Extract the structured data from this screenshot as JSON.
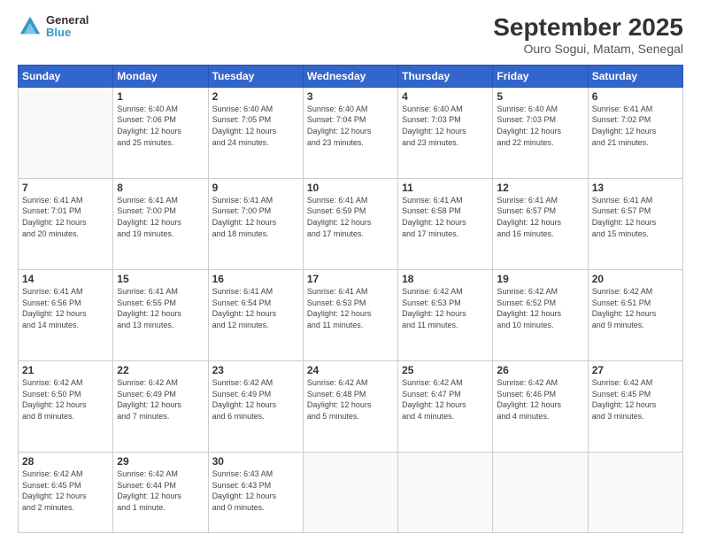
{
  "logo": {
    "line1": "General",
    "line2": "Blue"
  },
  "title": "September 2025",
  "subtitle": "Ouro Sogui, Matam, Senegal",
  "days_header": [
    "Sunday",
    "Monday",
    "Tuesday",
    "Wednesday",
    "Thursday",
    "Friday",
    "Saturday"
  ],
  "weeks": [
    [
      {
        "day": "",
        "info": ""
      },
      {
        "day": "1",
        "info": "Sunrise: 6:40 AM\nSunset: 7:06 PM\nDaylight: 12 hours\nand 25 minutes."
      },
      {
        "day": "2",
        "info": "Sunrise: 6:40 AM\nSunset: 7:05 PM\nDaylight: 12 hours\nand 24 minutes."
      },
      {
        "day": "3",
        "info": "Sunrise: 6:40 AM\nSunset: 7:04 PM\nDaylight: 12 hours\nand 23 minutes."
      },
      {
        "day": "4",
        "info": "Sunrise: 6:40 AM\nSunset: 7:03 PM\nDaylight: 12 hours\nand 23 minutes."
      },
      {
        "day": "5",
        "info": "Sunrise: 6:40 AM\nSunset: 7:03 PM\nDaylight: 12 hours\nand 22 minutes."
      },
      {
        "day": "6",
        "info": "Sunrise: 6:41 AM\nSunset: 7:02 PM\nDaylight: 12 hours\nand 21 minutes."
      }
    ],
    [
      {
        "day": "7",
        "info": "Sunrise: 6:41 AM\nSunset: 7:01 PM\nDaylight: 12 hours\nand 20 minutes."
      },
      {
        "day": "8",
        "info": "Sunrise: 6:41 AM\nSunset: 7:00 PM\nDaylight: 12 hours\nand 19 minutes."
      },
      {
        "day": "9",
        "info": "Sunrise: 6:41 AM\nSunset: 7:00 PM\nDaylight: 12 hours\nand 18 minutes."
      },
      {
        "day": "10",
        "info": "Sunrise: 6:41 AM\nSunset: 6:59 PM\nDaylight: 12 hours\nand 17 minutes."
      },
      {
        "day": "11",
        "info": "Sunrise: 6:41 AM\nSunset: 6:58 PM\nDaylight: 12 hours\nand 17 minutes."
      },
      {
        "day": "12",
        "info": "Sunrise: 6:41 AM\nSunset: 6:57 PM\nDaylight: 12 hours\nand 16 minutes."
      },
      {
        "day": "13",
        "info": "Sunrise: 6:41 AM\nSunset: 6:57 PM\nDaylight: 12 hours\nand 15 minutes."
      }
    ],
    [
      {
        "day": "14",
        "info": "Sunrise: 6:41 AM\nSunset: 6:56 PM\nDaylight: 12 hours\nand 14 minutes."
      },
      {
        "day": "15",
        "info": "Sunrise: 6:41 AM\nSunset: 6:55 PM\nDaylight: 12 hours\nand 13 minutes."
      },
      {
        "day": "16",
        "info": "Sunrise: 6:41 AM\nSunset: 6:54 PM\nDaylight: 12 hours\nand 12 minutes."
      },
      {
        "day": "17",
        "info": "Sunrise: 6:41 AM\nSunset: 6:53 PM\nDaylight: 12 hours\nand 11 minutes."
      },
      {
        "day": "18",
        "info": "Sunrise: 6:42 AM\nSunset: 6:53 PM\nDaylight: 12 hours\nand 11 minutes."
      },
      {
        "day": "19",
        "info": "Sunrise: 6:42 AM\nSunset: 6:52 PM\nDaylight: 12 hours\nand 10 minutes."
      },
      {
        "day": "20",
        "info": "Sunrise: 6:42 AM\nSunset: 6:51 PM\nDaylight: 12 hours\nand 9 minutes."
      }
    ],
    [
      {
        "day": "21",
        "info": "Sunrise: 6:42 AM\nSunset: 6:50 PM\nDaylight: 12 hours\nand 8 minutes."
      },
      {
        "day": "22",
        "info": "Sunrise: 6:42 AM\nSunset: 6:49 PM\nDaylight: 12 hours\nand 7 minutes."
      },
      {
        "day": "23",
        "info": "Sunrise: 6:42 AM\nSunset: 6:49 PM\nDaylight: 12 hours\nand 6 minutes."
      },
      {
        "day": "24",
        "info": "Sunrise: 6:42 AM\nSunset: 6:48 PM\nDaylight: 12 hours\nand 5 minutes."
      },
      {
        "day": "25",
        "info": "Sunrise: 6:42 AM\nSunset: 6:47 PM\nDaylight: 12 hours\nand 4 minutes."
      },
      {
        "day": "26",
        "info": "Sunrise: 6:42 AM\nSunset: 6:46 PM\nDaylight: 12 hours\nand 4 minutes."
      },
      {
        "day": "27",
        "info": "Sunrise: 6:42 AM\nSunset: 6:45 PM\nDaylight: 12 hours\nand 3 minutes."
      }
    ],
    [
      {
        "day": "28",
        "info": "Sunrise: 6:42 AM\nSunset: 6:45 PM\nDaylight: 12 hours\nand 2 minutes."
      },
      {
        "day": "29",
        "info": "Sunrise: 6:42 AM\nSunset: 6:44 PM\nDaylight: 12 hours\nand 1 minute."
      },
      {
        "day": "30",
        "info": "Sunrise: 6:43 AM\nSunset: 6:43 PM\nDaylight: 12 hours\nand 0 minutes."
      },
      {
        "day": "",
        "info": ""
      },
      {
        "day": "",
        "info": ""
      },
      {
        "day": "",
        "info": ""
      },
      {
        "day": "",
        "info": ""
      }
    ]
  ]
}
